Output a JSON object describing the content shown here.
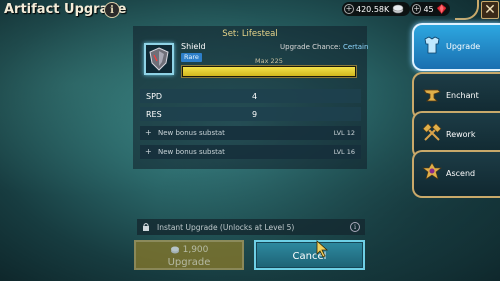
{
  "header": {
    "title": "Artifact Upgrade",
    "info_glyph": "i",
    "silver_amount": "420.58K",
    "gems_amount": "45",
    "close_glyph": "✕"
  },
  "artifact": {
    "set_title": "Set: Lifesteal",
    "name": "Shield",
    "rarity": "Rare",
    "upgrade_chance_label": "Upgrade Chance:",
    "upgrade_chance_value": "Certain",
    "max_label": "Max 225",
    "level_fill_fraction": 1.0
  },
  "stats": [
    {
      "name": "SPD",
      "value": "4"
    },
    {
      "name": "RES",
      "value": "9"
    }
  ],
  "bonus_substats": [
    {
      "label": "New bonus substat",
      "level": "LVL 12"
    },
    {
      "label": "New bonus substat",
      "level": "LVL 16"
    }
  ],
  "tabs": [
    {
      "label": "Upgrade",
      "icon": "armor-icon",
      "active": true
    },
    {
      "label": "Enchant",
      "icon": "anvil-icon",
      "active": false
    },
    {
      "label": "Rework",
      "icon": "hammers-icon",
      "active": false
    },
    {
      "label": "Ascend",
      "icon": "ascend-crest-icon",
      "active": false
    }
  ],
  "instant_upgrade": {
    "text": "Instant Upgrade (Unlocks at Level 5)"
  },
  "buttons": {
    "upgrade_cost": "1,900",
    "upgrade_label": "Upgrade",
    "cancel_label": "Cancel"
  },
  "colors": {
    "accent_gold": "#c9a96a",
    "active_tab": "#2da7e0",
    "level_bar": "#f3e24a",
    "rarity": "#2d7fc9"
  }
}
